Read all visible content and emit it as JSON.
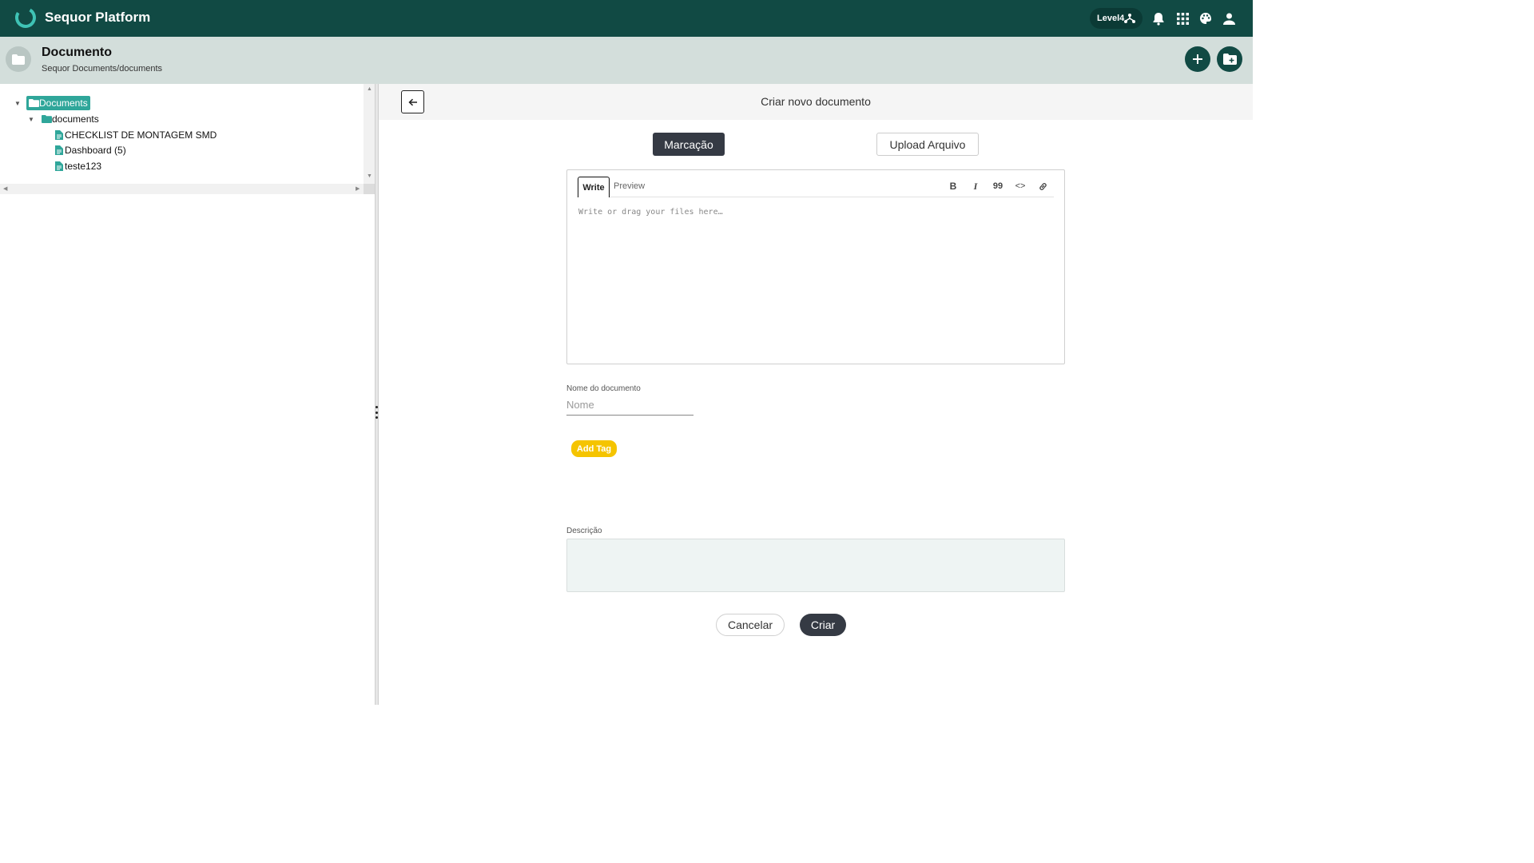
{
  "app": {
    "title": "Sequor Platform",
    "level_label": "Level4"
  },
  "topbar_icons": [
    "level-hierarchy-icon",
    "bell-icon",
    "apps-grid-icon",
    "palette-icon",
    "user-icon"
  ],
  "header": {
    "title": "Documento",
    "subtitle": "Sequor Documents/documents"
  },
  "tree": {
    "root": "Documents",
    "folder": "documents",
    "files": [
      "CHECKLIST DE MONTAGEM SMD",
      "Dashboard (5)",
      "teste123"
    ]
  },
  "form": {
    "title": "Criar novo documento",
    "mode_markup": "Marcação",
    "mode_upload": "Upload Arquivo",
    "editor": {
      "tab_write": "Write",
      "tab_preview": "Preview",
      "placeholder": "Write or drag your files here…",
      "tools": {
        "bold": "B",
        "italic": "I",
        "quote": "99",
        "code": "<>"
      }
    },
    "name_label": "Nome do documento",
    "name_placeholder": "Nome",
    "add_tag": "Add Tag",
    "description_label": "Descrição",
    "cancel": "Cancelar",
    "create": "Criar"
  },
  "colors": {
    "primary": "#114a44",
    "header_bg": "#d3dedb",
    "tree_highlight": "#2fa69a",
    "tag": "#f5c400",
    "dark_button": "#353a44"
  }
}
